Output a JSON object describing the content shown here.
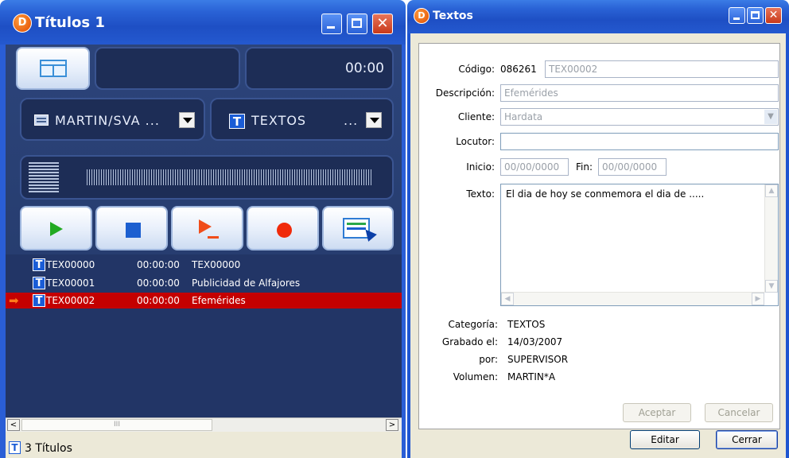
{
  "left_window": {
    "title": "Títulos 1",
    "logo_letter": "D",
    "time_display": "00:00",
    "source_combo": "MARTIN/SVA ...",
    "category_combo_label": "TEXTOS",
    "category_combo_ellipsis": "...",
    "list": [
      {
        "id": "TEX00000",
        "duration": "00:00:00",
        "name": "TEX00000",
        "selected": false
      },
      {
        "id": "TEX00001",
        "duration": "00:00:00",
        "name": "Publicidad de Alfajores",
        "selected": false
      },
      {
        "id": "TEX00002",
        "duration": "00:00:00",
        "name": "Efemérides",
        "selected": true
      }
    ],
    "status": "3 Títulos",
    "icons": {
      "title_type": "T",
      "hscroll_thumb": "III"
    },
    "colors": {
      "selected_row": "#c40000",
      "list_bg": "#223566"
    }
  },
  "right_window": {
    "title": "Textos",
    "logo_letter": "D",
    "fields": {
      "codigo_label": "Código:",
      "codigo_value": "086261",
      "codigo_field": "TEX00002",
      "descripcion_label": "Descripción:",
      "descripcion_value": "Efemérides",
      "cliente_label": "Cliente:",
      "cliente_value": "Hardata",
      "locutor_label": "Locutor:",
      "locutor_value": "",
      "inicio_label": "Inicio:",
      "inicio_value": "00/00/0000",
      "fin_label": "Fin:",
      "fin_value": "00/00/0000",
      "texto_label": "Texto:",
      "texto_value": "El dia de hoy se conmemora el dia de ....."
    },
    "info": {
      "categoria_label": "Categoría:",
      "categoria_value": "TEXTOS",
      "grabado_label": "Grabado el:",
      "grabado_value": "14/03/2007",
      "por_label": "por:",
      "por_value": "SUPERVISOR",
      "volumen_label": "Volumen:",
      "volumen_value": "MARTIN*A"
    },
    "buttons": {
      "aceptar": "Aceptar",
      "cancelar": "Cancelar",
      "editar": "Editar",
      "cerrar": "Cerrar"
    }
  }
}
